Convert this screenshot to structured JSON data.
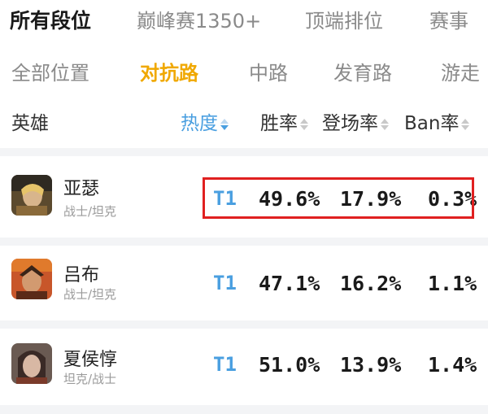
{
  "tabs_primary": [
    {
      "label": "所有段位",
      "active": true
    },
    {
      "label": "巅峰赛1350+",
      "active": false
    },
    {
      "label": "顶端排位",
      "active": false
    },
    {
      "label": "赛事",
      "active": false
    }
  ],
  "tabs_lane": [
    {
      "label": "全部位置",
      "active": false
    },
    {
      "label": "对抗路",
      "active": true
    },
    {
      "label": "中路",
      "active": false
    },
    {
      "label": "发育路",
      "active": false
    },
    {
      "label": "游走",
      "active": false
    }
  ],
  "table_header": {
    "hero": "英雄",
    "heat": "热度",
    "win_rate": "胜率",
    "pick_rate": "登场率",
    "ban_rate": "Ban率"
  },
  "heroes": [
    {
      "name": "亚瑟",
      "role": "战士/坦克",
      "tier": "T1",
      "win_rate": "49.6%",
      "pick_rate": "17.9%",
      "ban_rate": "0.3%"
    },
    {
      "name": "吕布",
      "role": "战士/坦克",
      "tier": "T1",
      "win_rate": "47.1%",
      "pick_rate": "16.2%",
      "ban_rate": "1.1%"
    },
    {
      "name": "夏侯惇",
      "role": "坦克/战士",
      "tier": "T1",
      "win_rate": "51.0%",
      "pick_rate": "13.9%",
      "ban_rate": "1.4%"
    }
  ],
  "colors": {
    "accent_tab": "#f0a800",
    "tier_blue": "#4a9fe0",
    "highlight_red": "#e02020"
  }
}
